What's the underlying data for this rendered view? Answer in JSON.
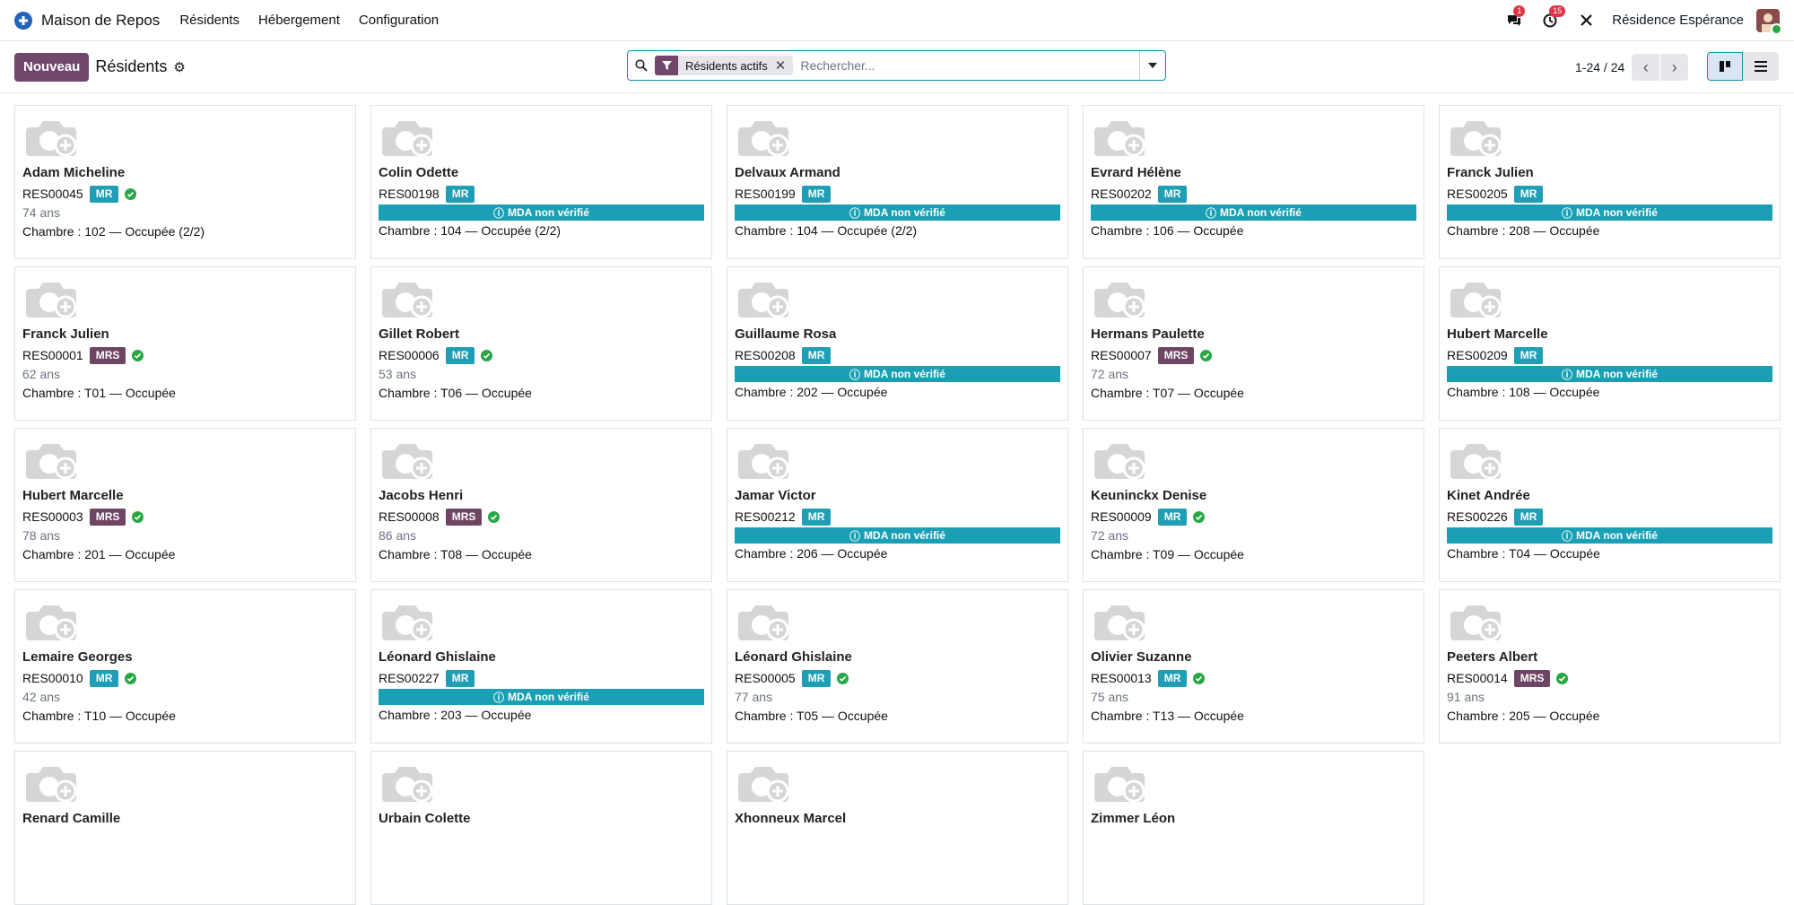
{
  "navbar": {
    "app_name": "Maison de Repos",
    "menu": [
      "Résidents",
      "Hébergement",
      "Configuration"
    ],
    "messages_badge": "1",
    "activities_badge": "15",
    "company": "Résidence Espérance"
  },
  "control": {
    "new_label": "Nouveau",
    "breadcrumb": "Résidents",
    "facet": "Résidents actifs",
    "search_placeholder": "Rechercher...",
    "pager": "1-24 / 24"
  },
  "colors": {
    "primary": "#71476d",
    "accent": "#1591a9",
    "mr_tag": "#1f9fb6",
    "mrs_tag": "#6f4564",
    "check": "#28a745"
  },
  "cards": [
    {
      "name": "Adam Micheline",
      "ref": "RES00045",
      "tag": "MR",
      "verified": true,
      "age": "74 ans",
      "room": "Chambre : 102 — Occupée (2/2)"
    },
    {
      "name": "Colin Odette",
      "ref": "RES00198",
      "tag": "MR",
      "verified": false,
      "mda": "MDA non vérifié",
      "room": "Chambre : 104 — Occupée (2/2)"
    },
    {
      "name": "Delvaux Armand",
      "ref": "RES00199",
      "tag": "MR",
      "verified": false,
      "mda": "MDA non vérifié",
      "room": "Chambre : 104 — Occupée (2/2)"
    },
    {
      "name": "Evrard Hélène",
      "ref": "RES00202",
      "tag": "MR",
      "verified": false,
      "mda": "MDA non vérifié",
      "room": "Chambre : 106 — Occupée"
    },
    {
      "name": "Franck Julien",
      "ref": "RES00205",
      "tag": "MR",
      "verified": false,
      "mda": "MDA non vérifié",
      "room": "Chambre : 208 — Occupée"
    },
    {
      "name": "Franck Julien",
      "ref": "RES00001",
      "tag": "MRS",
      "verified": true,
      "age": "62 ans",
      "room": "Chambre : T01 — Occupée"
    },
    {
      "name": "Gillet Robert",
      "ref": "RES00006",
      "tag": "MR",
      "verified": true,
      "age": "53 ans",
      "room": "Chambre : T06 — Occupée"
    },
    {
      "name": "Guillaume Rosa",
      "ref": "RES00208",
      "tag": "MR",
      "verified": false,
      "mda": "MDA non vérifié",
      "room": "Chambre : 202 — Occupée"
    },
    {
      "name": "Hermans Paulette",
      "ref": "RES00007",
      "tag": "MRS",
      "verified": true,
      "age": "72 ans",
      "room": "Chambre : T07 — Occupée"
    },
    {
      "name": "Hubert Marcelle",
      "ref": "RES00209",
      "tag": "MR",
      "verified": false,
      "mda": "MDA non vérifié",
      "room": "Chambre : 108 — Occupée"
    },
    {
      "name": "Hubert Marcelle",
      "ref": "RES00003",
      "tag": "MRS",
      "verified": true,
      "age": "78 ans",
      "room": "Chambre : 201 — Occupée"
    },
    {
      "name": "Jacobs Henri",
      "ref": "RES00008",
      "tag": "MRS",
      "verified": true,
      "age": "86 ans",
      "room": "Chambre : T08 — Occupée"
    },
    {
      "name": "Jamar Victor",
      "ref": "RES00212",
      "tag": "MR",
      "verified": false,
      "mda": "MDA non vérifié",
      "room": "Chambre : 206 — Occupée"
    },
    {
      "name": "Keuninckx Denise",
      "ref": "RES00009",
      "tag": "MR",
      "verified": true,
      "age": "72 ans",
      "room": "Chambre : T09 — Occupée"
    },
    {
      "name": "Kinet Andrée",
      "ref": "RES00226",
      "tag": "MR",
      "verified": false,
      "mda": "MDA non vérifié",
      "room": "Chambre : T04 — Occupée"
    },
    {
      "name": "Lemaire Georges",
      "ref": "RES00010",
      "tag": "MR",
      "verified": true,
      "age": "42 ans",
      "room": "Chambre : T10 — Occupée"
    },
    {
      "name": "Léonard Ghislaine",
      "ref": "RES00227",
      "tag": "MR",
      "verified": false,
      "mda": "MDA non vérifié",
      "room": "Chambre : 203 — Occupée"
    },
    {
      "name": "Léonard Ghislaine",
      "ref": "RES00005",
      "tag": "MR",
      "verified": true,
      "age": "77 ans",
      "room": "Chambre : T05 — Occupée"
    },
    {
      "name": "Olivier Suzanne",
      "ref": "RES00013",
      "tag": "MR",
      "verified": true,
      "age": "75 ans",
      "room": "Chambre : T13 — Occupée"
    },
    {
      "name": "Peeters Albert",
      "ref": "RES00014",
      "tag": "MRS",
      "verified": true,
      "age": "91 ans",
      "room": "Chambre : 205 — Occupée"
    },
    {
      "name": "Renard Camille"
    },
    {
      "name": "Urbain Colette"
    },
    {
      "name": "Xhonneux Marcel"
    },
    {
      "name": "Zimmer Léon"
    }
  ]
}
